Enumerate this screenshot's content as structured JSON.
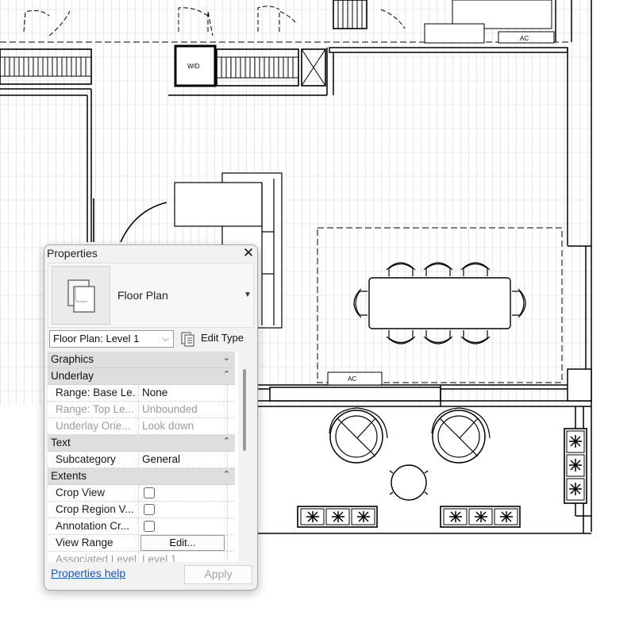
{
  "canvas": {
    "labels": {
      "washer_dryer": "W/D",
      "ac_top": "AC",
      "ac_dining": "AC"
    }
  },
  "properties": {
    "title": "Properties",
    "type_name": "Floor Plan",
    "instance_selector": "Floor Plan: Level 1",
    "edit_type_label": "Edit Type",
    "groups": {
      "graphics": "Graphics",
      "underlay": "Underlay",
      "text": "Text",
      "extents": "Extents"
    },
    "rows": {
      "range_base": {
        "name": "Range: Base Le...",
        "value": "None"
      },
      "range_top": {
        "name": "Range: Top Le...",
        "value": "Unbounded"
      },
      "underlay_orient": {
        "name": "Underlay Orie...",
        "value": "Look down"
      },
      "subcategory": {
        "name": "Subcategory",
        "value": "General"
      },
      "crop_view": {
        "name": "Crop View"
      },
      "crop_region": {
        "name": "Crop Region V..."
      },
      "annotation_crop": {
        "name": "Annotation Cr..."
      },
      "view_range": {
        "name": "View Range",
        "button": "Edit..."
      },
      "associated_level": {
        "name": "Associated Level",
        "value": "Level 1"
      }
    },
    "help_link": "Properties help",
    "apply_button": "Apply"
  }
}
